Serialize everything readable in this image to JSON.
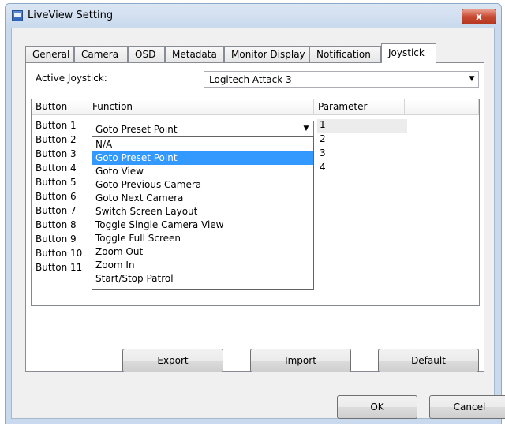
{
  "window": {
    "title": "LiveView Setting",
    "close_label": "x"
  },
  "tabs": [
    {
      "label": "General"
    },
    {
      "label": "Camera"
    },
    {
      "label": "OSD"
    },
    {
      "label": "Metadata"
    },
    {
      "label": "Monitor Display"
    },
    {
      "label": "Notification"
    },
    {
      "label": "Joystick"
    }
  ],
  "active_tab": "Joystick",
  "joystick": {
    "active_label": "Active Joystick:",
    "active_value": "Logitech Attack 3"
  },
  "grid": {
    "columns": [
      "Button",
      "Function",
      "Parameter"
    ],
    "buttons": [
      "Button 1",
      "Button 2",
      "Button 3",
      "Button 4",
      "Button 5",
      "Button 6",
      "Button 7",
      "Button 8",
      "Button 9",
      "Button 10",
      "Button 11"
    ],
    "parameters": [
      "1",
      "2",
      "3",
      "4"
    ],
    "selected_function": "Goto Preset Point"
  },
  "dropdown": {
    "options": [
      "N/A",
      "Goto Preset Point",
      "Goto View",
      "Goto Previous Camera",
      "Goto Next Camera",
      "Switch Screen Layout",
      "Toggle Single Camera View",
      "Toggle Full Screen",
      "Zoom Out",
      "Zoom In",
      "Start/Stop Patrol"
    ],
    "highlighted_index": 1
  },
  "panel_buttons": {
    "export": "Export",
    "import": "Import",
    "default": "Default"
  },
  "dialog_buttons": {
    "ok": "OK",
    "cancel": "Cancel"
  },
  "icons": {
    "combo_arrow": "chevron-down-icon",
    "close": "close-icon",
    "app": "app-icon"
  }
}
